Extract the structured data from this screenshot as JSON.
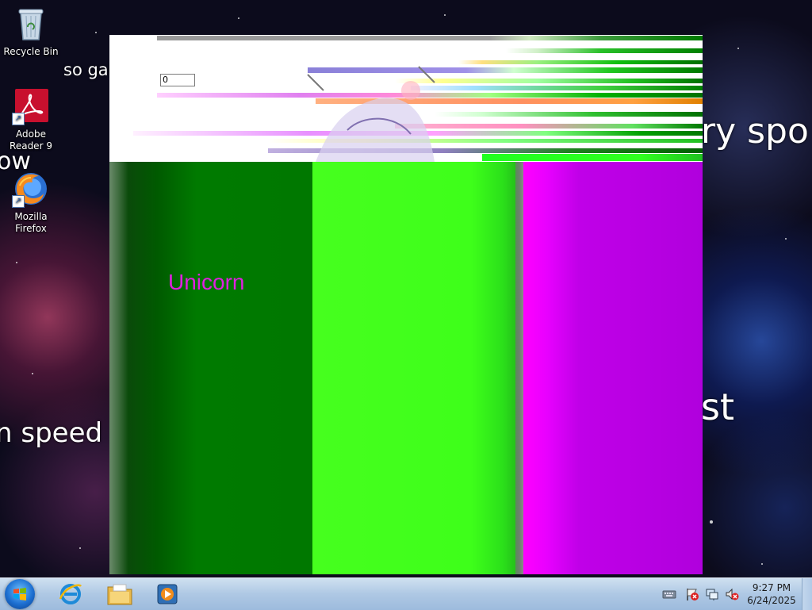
{
  "desktop": {
    "wallpaper_texts": [
      "so gal",
      "ow",
      "n speed",
      "ry spo",
      "st"
    ],
    "icons": [
      {
        "label": "Recycle Bin",
        "icon": "recycle-bin-icon"
      },
      {
        "label": "Adobe Reader 9",
        "icon": "adobe-reader-icon"
      },
      {
        "label": "Mozilla Firefox",
        "icon": "firefox-icon"
      }
    ]
  },
  "window": {
    "input_value": "0",
    "unicorn_label": "Unicorn",
    "colors": {
      "green": "#007800",
      "lime": "#46ff1e",
      "purple": "#b000dd",
      "unicorn_text": "#e020e0"
    }
  },
  "taskbar": {
    "pinned": [
      {
        "name": "internet-explorer",
        "icon": "internet-explorer-icon"
      },
      {
        "name": "file-explorer",
        "icon": "folder-icon"
      },
      {
        "name": "media-player",
        "icon": "media-player-icon"
      }
    ],
    "tray_icons": [
      "keyboard-icon",
      "action-center-flag-icon",
      "network-icon",
      "volume-muted-icon"
    ],
    "clock": {
      "time": "9:27 PM",
      "date": "6/24/2025"
    }
  }
}
